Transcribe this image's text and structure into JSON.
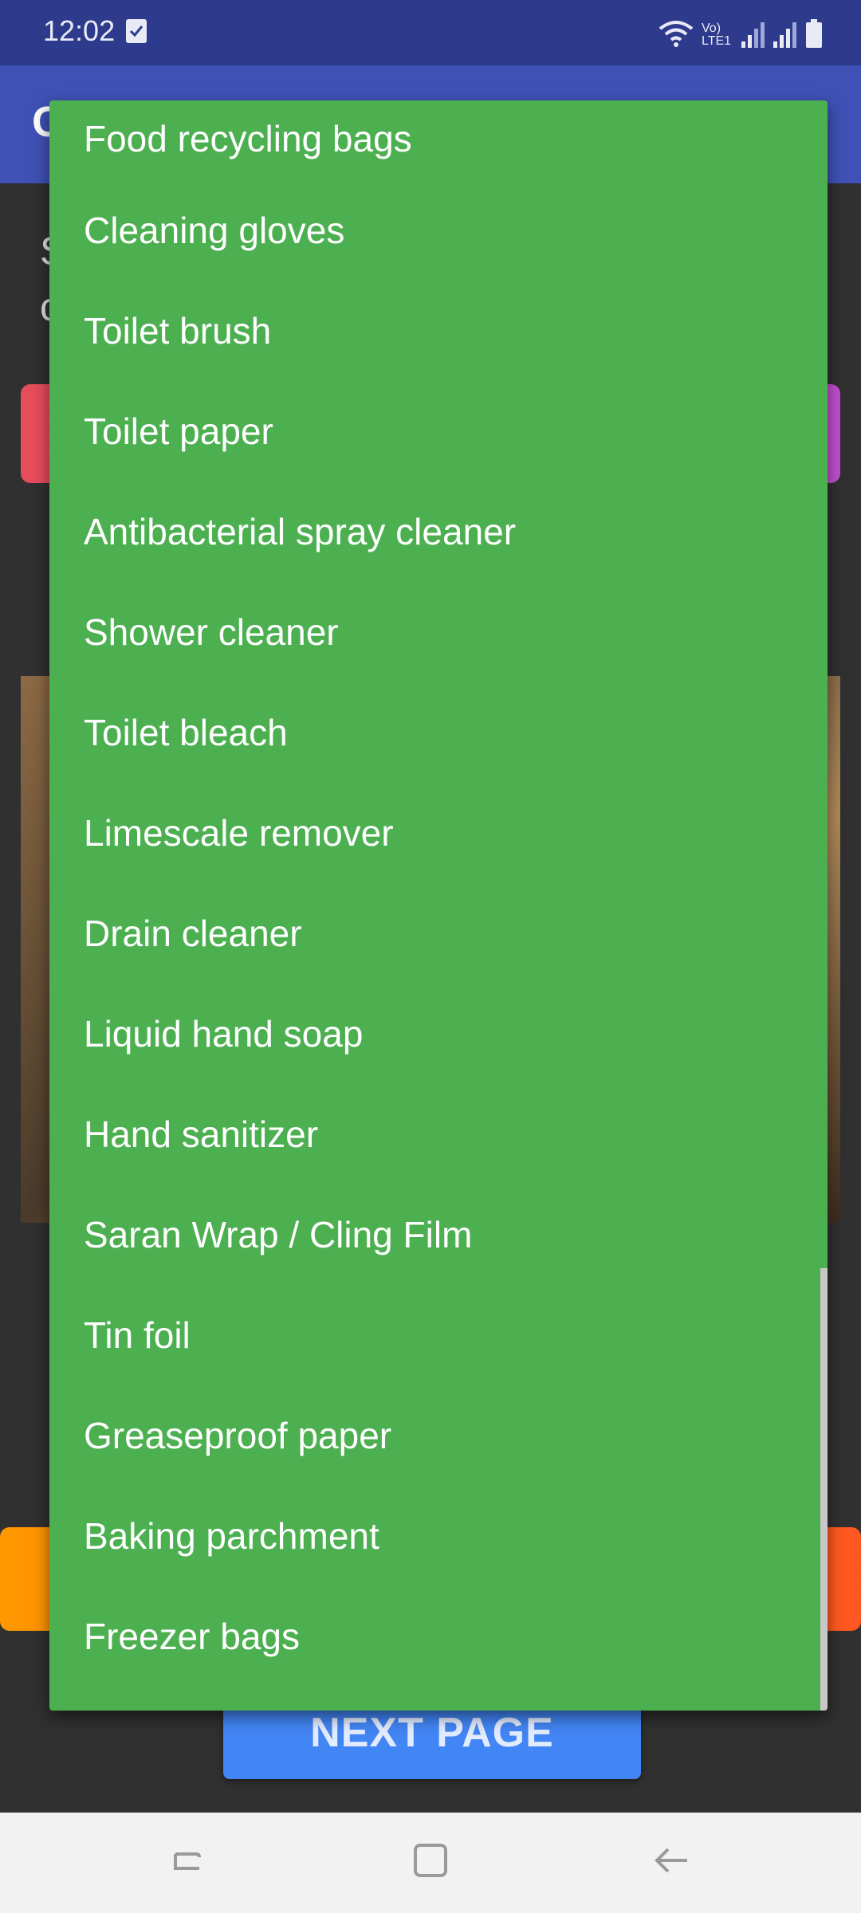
{
  "status_bar": {
    "time": "12:02",
    "lte_label": "Vo) LTE1"
  },
  "app_bar": {
    "title_initial": "C"
  },
  "background": {
    "text_line1": "S",
    "text_line2": "c",
    "next_button_label": "NEXT PAGE"
  },
  "dropdown": {
    "items": [
      "Food recycling bags",
      "Cleaning gloves",
      "Toilet brush",
      "Toilet paper",
      "Antibacterial spray cleaner",
      "Shower cleaner",
      "Toilet bleach",
      "Limescale remover",
      "Drain cleaner",
      "Liquid hand soap",
      "Hand sanitizer",
      "Saran Wrap / Cling Film",
      "Tin foil",
      "Greaseproof paper",
      "Baking parchment",
      "Freezer bags"
    ]
  },
  "colors": {
    "dropdown_bg": "#4caf50",
    "app_bar": "#3f51b5",
    "status_bar": "#2e3a8c",
    "next_button": "#4285f4"
  }
}
